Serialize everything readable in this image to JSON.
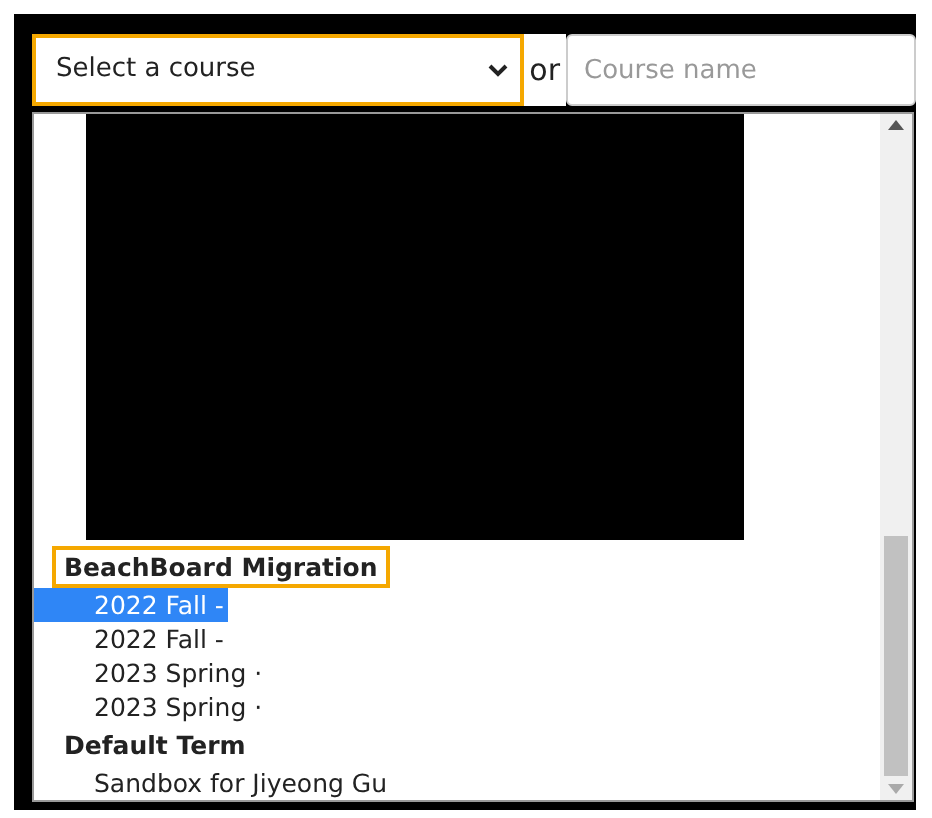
{
  "course_select": {
    "value": "Select a course",
    "highlighted": true
  },
  "separator": "or",
  "course_name_field": {
    "placeholder": "Course name"
  },
  "course_list": {
    "groups": [
      {
        "label": "BeachBoard Migration",
        "highlighted": true,
        "options": [
          {
            "label": "2022 Fall -",
            "selected": true
          },
          {
            "label": "2022 Fall -",
            "selected": false
          },
          {
            "label": "2023 Spring ·",
            "selected": false
          },
          {
            "label": "2023 Spring ·",
            "selected": false
          }
        ]
      },
      {
        "label": "Default Term",
        "highlighted": false,
        "options": [
          {
            "label": "Sandbox for Jiyeong Gu",
            "selected": false
          }
        ]
      }
    ]
  }
}
